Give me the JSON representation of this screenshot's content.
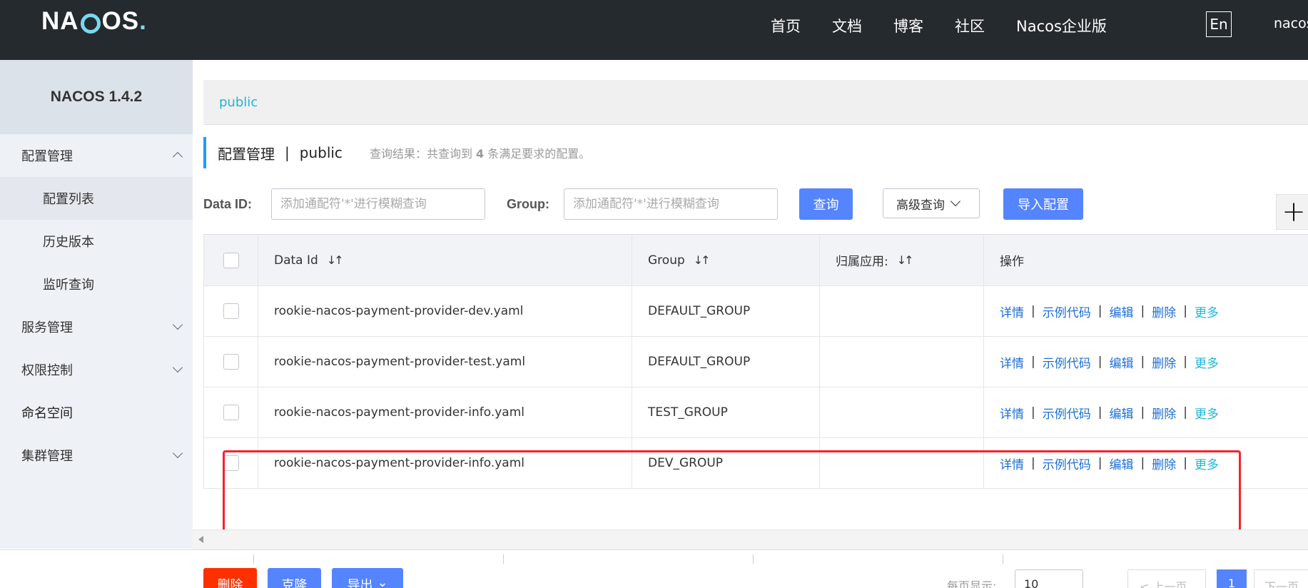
{
  "header": {
    "logo": "NACOS.",
    "nav": [
      "首页",
      "文档",
      "博客",
      "社区",
      "Nacos企业版"
    ],
    "lang": "En",
    "user": "nacos"
  },
  "sidebar": {
    "title": "NACOS 1.4.2",
    "items": [
      {
        "label": "配置管理",
        "expanded": true
      },
      {
        "label": "配置列表",
        "sub": true,
        "active": true
      },
      {
        "label": "历史版本",
        "sub": true
      },
      {
        "label": "监听查询",
        "sub": true
      },
      {
        "label": "服务管理",
        "expanded": false
      },
      {
        "label": "权限控制",
        "expanded": false
      },
      {
        "label": "命名空间"
      },
      {
        "label": "集群管理",
        "expanded": false
      }
    ]
  },
  "namespace": {
    "current": "public"
  },
  "breadcrumb": {
    "title": "配置管理",
    "separator": "|",
    "namespace": "public",
    "hint_prefix": "查询结果：共查询到",
    "hint_count": "4",
    "hint_suffix": "条满足要求的配置。"
  },
  "search": {
    "data_id_label": "Data ID:",
    "data_id_placeholder": "添加通配符'*'进行模糊查询",
    "group_label": "Group:",
    "group_placeholder": "添加通配符'*'进行模糊查询",
    "query_button": "查询",
    "advanced_button": "高级查询",
    "import_button": "导入配置",
    "plus": "+"
  },
  "table": {
    "columns": [
      "Data Id",
      "Group",
      "归属应用:",
      "操作"
    ],
    "sort_glyph": "↓↑",
    "rows": [
      {
        "data_id": "rookie-nacos-payment-provider-dev.yaml",
        "group": "DEFAULT_GROUP",
        "app": ""
      },
      {
        "data_id": "rookie-nacos-payment-provider-test.yaml",
        "group": "DEFAULT_GROUP",
        "app": ""
      },
      {
        "data_id": "rookie-nacos-payment-provider-info.yaml",
        "group": "TEST_GROUP",
        "app": ""
      },
      {
        "data_id": "rookie-nacos-payment-provider-info.yaml",
        "group": "DEV_GROUP",
        "app": ""
      }
    ],
    "ops": {
      "detail": "详情",
      "sample": "示例代码",
      "edit": "编辑",
      "delete": "删除",
      "more": "更多",
      "sep": "|"
    }
  },
  "footer": {
    "delete_button": "删除",
    "clone_button": "克隆",
    "export_button": "导出",
    "page_size_label": "每页显示:",
    "page_size": "10",
    "prev": "上一页",
    "current_page": "1",
    "next": "下一页"
  },
  "colors": {
    "header_bg": "#252a2f",
    "primary": "#5584ff",
    "danger": "#ff3000",
    "link": "#1a6fd8",
    "link_more": "#1fb5d6",
    "highlight": "#f5222d"
  }
}
